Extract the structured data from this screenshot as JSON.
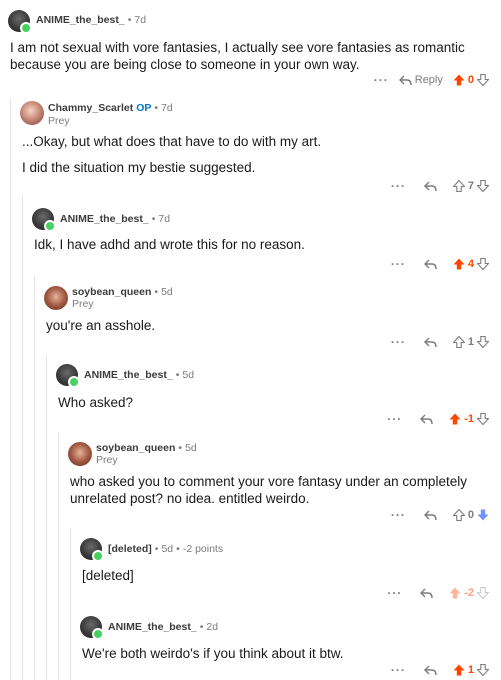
{
  "comments": [
    {
      "author": "ANIME_the_best_",
      "age": "7d",
      "text_lines": [
        "I am not sexual with vore fantasies, I actually see vore fantasies as romantic",
        "because you are being close to someone in your own way."
      ],
      "reply_label": "Reply",
      "score": "0",
      "vote_state": "upvoted"
    },
    {
      "author": "Chammy_Scarlet",
      "op_badge": "OP",
      "age": "7d",
      "flair": "Prey",
      "text_lines": [
        "...Okay, but what does that have to do with my art.",
        "I did the situation my bestie suggested."
      ],
      "score": "7",
      "vote_state": "none"
    },
    {
      "author": "ANIME_the_best_",
      "age": "7d",
      "text_lines": [
        "Idk, I have adhd and wrote this for no reason."
      ],
      "score": "4",
      "vote_state": "upvoted"
    },
    {
      "author": "soybean_queen",
      "age": "5d",
      "flair": "Prey",
      "text_lines": [
        "you're an asshole."
      ],
      "score": "1",
      "vote_state": "none"
    },
    {
      "author": "ANIME_the_best_",
      "age": "5d",
      "text_lines": [
        "Who asked?"
      ],
      "score": "-1",
      "vote_state": "upvoted"
    },
    {
      "author": "soybean_queen",
      "age": "5d",
      "flair": "Prey",
      "text_lines": [
        "who asked you to comment your vore fantasy under an completely",
        "unrelated post? no idea. entitled weirdo."
      ],
      "score": "0",
      "vote_state": "downvoted"
    },
    {
      "author": "[deleted]",
      "age": "5d",
      "points": "-2 points",
      "text_lines": [
        "[deleted]"
      ],
      "score": "-2",
      "vote_state": "upvoted-faded"
    },
    {
      "author": "ANIME_the_best_",
      "age": "2d",
      "text_lines": [
        "We're both weirdo's if you think about it btw."
      ],
      "score": "1",
      "vote_state": "upvoted"
    }
  ],
  "icons": {
    "more": "more-dots-icon",
    "reply": "reply-arrow-icon",
    "upvote": "upvote-arrow-icon",
    "downvote": "downvote-arrow-icon"
  },
  "colors": {
    "upvote": "#ff4500",
    "downvote": "#7193ff",
    "op": "#0079d3",
    "online": "#46d160"
  },
  "more_label": "···",
  "separator": "•"
}
